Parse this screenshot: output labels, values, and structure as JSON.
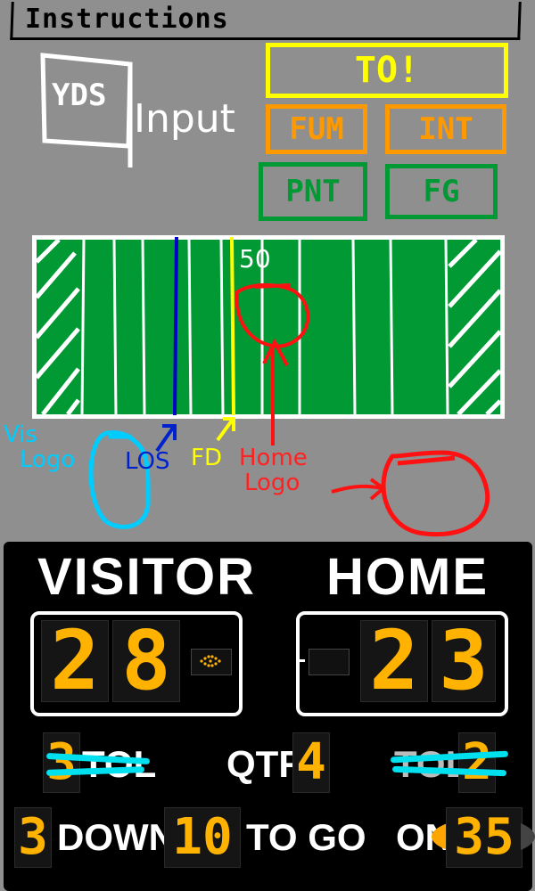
{
  "instructions": {
    "title": "Instructions"
  },
  "input_legend": {
    "yds_label": "YDS",
    "input_label": "Input",
    "buttons": {
      "to": "TO!",
      "fum": "FUM",
      "int": "INT",
      "pnt": "PNT",
      "fg": "FG"
    },
    "colors": {
      "to": "#ffff00",
      "turnover": "#ff9900",
      "kick": "#009933"
    }
  },
  "field_diagram": {
    "midfield_label": "50",
    "annotations": {
      "vis_logo": [
        "Vis",
        "Logo"
      ],
      "los": "LOS",
      "first_down": "FD",
      "home_logo": [
        "Home",
        "Logo"
      ]
    },
    "colors": {
      "turf": "#009933",
      "los_line": "#0000cc",
      "first_down_line": "#ffff00"
    }
  },
  "scoreboard": {
    "visitor": {
      "name": "VISITOR",
      "score": [
        "2",
        "8"
      ],
      "timeouts_left": "3",
      "tol_label": "TOL"
    },
    "home": {
      "name": "HOME",
      "score": [
        "2",
        "3"
      ],
      "timeouts_left": "2",
      "tol_label": "TOL"
    },
    "quarter": {
      "label": "QTR",
      "value": "4"
    },
    "down": {
      "value": "3",
      "label": "DOWN"
    },
    "to_go": {
      "value": "10",
      "label": "TO GO"
    },
    "ball_on": {
      "label": "ON",
      "value": "35"
    },
    "colors": {
      "digit": "#ffb300",
      "strike": "#00e0ee"
    }
  }
}
